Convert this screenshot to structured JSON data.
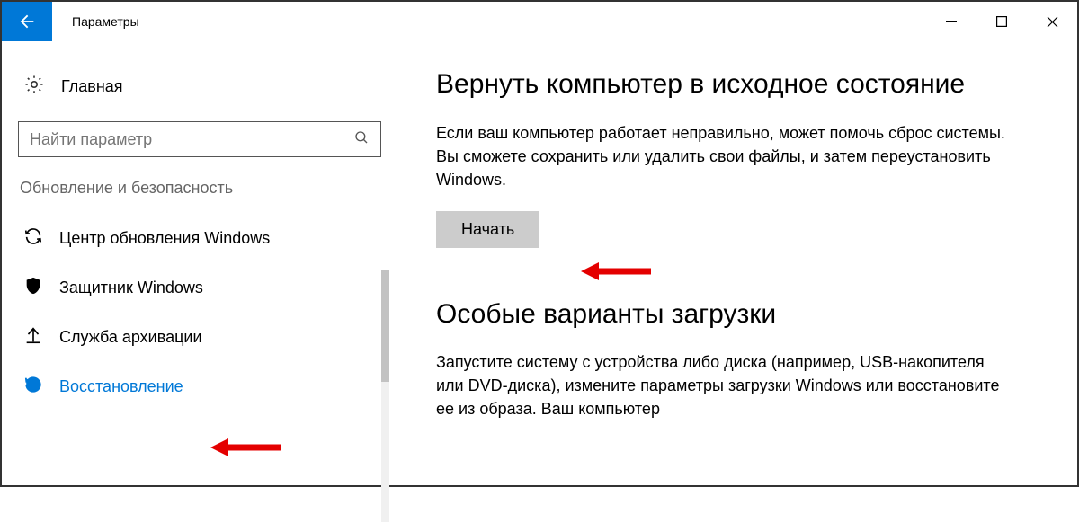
{
  "titlebar": {
    "title": "Параметры"
  },
  "sidebar": {
    "home": "Главная",
    "search_placeholder": "Найти параметр",
    "section": "Обновление и безопасность",
    "items": [
      {
        "label": "Центр обновления Windows"
      },
      {
        "label": "Защитник Windows"
      },
      {
        "label": "Служба архивации"
      },
      {
        "label": "Восстановление"
      }
    ]
  },
  "main": {
    "reset_title": "Вернуть компьютер в исходное состояние",
    "reset_desc": "Если ваш компьютер работает неправильно, может помочь сброс системы. Вы сможете сохранить или удалить свои файлы, и затем переустановить Windows.",
    "reset_button": "Начать",
    "advanced_title": "Особые варианты загрузки",
    "advanced_desc": "Запустите систему с устройства либо диска (например, USB-накопителя или DVD-диска), измените параметры загрузки Windows или восстановите ее из образа. Ваш компьютер"
  }
}
